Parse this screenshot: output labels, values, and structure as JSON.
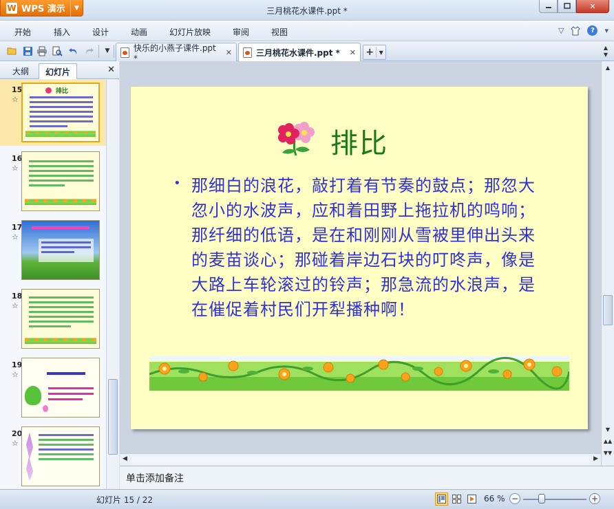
{
  "app": {
    "brand": "WPS 演示",
    "window_title": "三月桃花水课件.ppt *"
  },
  "menu": {
    "items": [
      "开始",
      "插入",
      "设计",
      "动画",
      "幻灯片放映",
      "审阅",
      "视图"
    ]
  },
  "doc_tabs": [
    {
      "label": "快乐的小燕子课件.ppt *",
      "active": false
    },
    {
      "label": "三月桃花水课件.ppt *",
      "active": true
    }
  ],
  "left_pane": {
    "tabs": [
      {
        "label": "大纲",
        "active": false
      },
      {
        "label": "幻灯片",
        "active": true
      }
    ],
    "thumbnails": [
      {
        "number": "15",
        "star": "☆",
        "selected": true,
        "title": "排比"
      },
      {
        "number": "16",
        "star": "☆",
        "selected": false
      },
      {
        "number": "17",
        "star": "☆",
        "selected": false
      },
      {
        "number": "18",
        "star": "☆",
        "selected": false
      },
      {
        "number": "19",
        "star": "☆",
        "selected": false
      },
      {
        "number": "20",
        "star": "☆",
        "selected": false
      }
    ]
  },
  "slide": {
    "title": "排比",
    "body": "那细白的浪花，敲打着有节奏的鼓点；那忽大忽小的水波声，应和着田野上拖拉机的鸣响；那纤细的低语，是在和刚刚从雪被里伸出头来的麦苗谈心；那碰着岸边石块的叮咚声，像是大路上车轮滚过的铃声；那急流的水浪声，是在催促着村民们开犁播种啊！"
  },
  "notes": {
    "placeholder": "单击添加备注"
  },
  "status": {
    "slide_counter": "幻灯片 15 / 22",
    "zoom_label": "66 %",
    "zoom_percent": 66
  },
  "colors": {
    "slide_background": "#ffffc4",
    "title_color": "#167a16",
    "body_color": "#3030d8",
    "brand_orange": "#e46e05"
  }
}
